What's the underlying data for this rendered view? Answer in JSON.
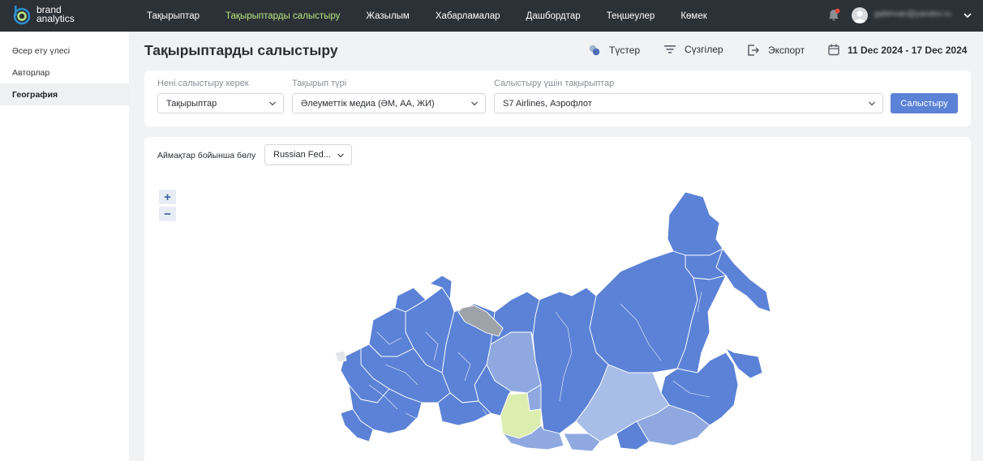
{
  "brand": {
    "line1": "brand",
    "line2": "analytics"
  },
  "nav": [
    {
      "label": "Тақырыптар",
      "active": false
    },
    {
      "label": "Тақырыптарды салыстыру",
      "active": true
    },
    {
      "label": "Жазылым",
      "active": false
    },
    {
      "label": "Хабарламалар",
      "active": false
    },
    {
      "label": "Дашбордтар",
      "active": false
    },
    {
      "label": "Теңшеулер",
      "active": false
    },
    {
      "label": "Көмек",
      "active": false
    }
  ],
  "user": {
    "email": "gabinvan@yandex.ru"
  },
  "sidebar": {
    "items": [
      {
        "label": "Әсер ету үлесі"
      },
      {
        "label": "Авторлар"
      },
      {
        "label": "География"
      }
    ]
  },
  "page": {
    "title": "Тақырыптарды салыстыру",
    "colors_label": "Түстер",
    "filters_label": "Сүзгілер",
    "export_label": "Экспорт",
    "date_range": "11 Dec 2024 - 17 Dec 2024"
  },
  "filters": {
    "compare_label": "Нені салыстыру керек",
    "compare_value": "Тақырыптар",
    "type_label": "Тақырып түрі",
    "type_value": "Әлеуметтік медиа (ӘМ, АА, ЖИ)",
    "themes_label": "Салыстыру үшін тақырыптар",
    "themes_value": "S7 Airlines, Аэрофлот",
    "compare_button": "Салыстыру"
  },
  "map": {
    "region_split_label": "Аймақтар бойынша бөлу",
    "region_value": "Russian Fed...",
    "zoom_in": "+",
    "zoom_out": "−",
    "colors": {
      "primary": "#5b82d6",
      "light": "#8fa9e0",
      "lighter": "#a8bde8",
      "highlight": "#dcedb0",
      "nodata": "#9ea3aa"
    }
  },
  "colors": {
    "topbar": "#2c3037",
    "accent_nav": "#b8e57e",
    "button": "#5b82d6"
  }
}
